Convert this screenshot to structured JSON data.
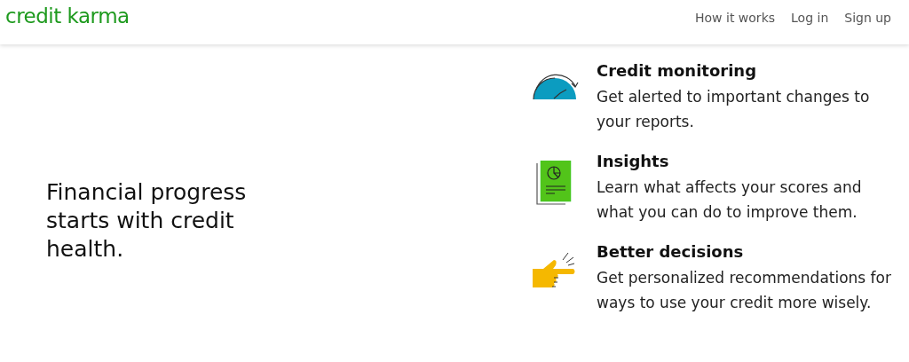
{
  "header": {
    "logo": "credit karma",
    "nav": [
      "How it works",
      "Log in",
      "Sign up"
    ]
  },
  "headline": "Financial progress starts with credit health.",
  "features": [
    {
      "kind": "gauge",
      "title": "Credit monitoring",
      "description": "Get alerted to important changes to your reports."
    },
    {
      "kind": "report",
      "title": "Insights",
      "description": "Learn what affects your scores and what you can do to improve them."
    },
    {
      "kind": "pointer",
      "title": "Better decisions",
      "description": "Get personalized recommendations for ways to use your credit more wisely."
    }
  ]
}
